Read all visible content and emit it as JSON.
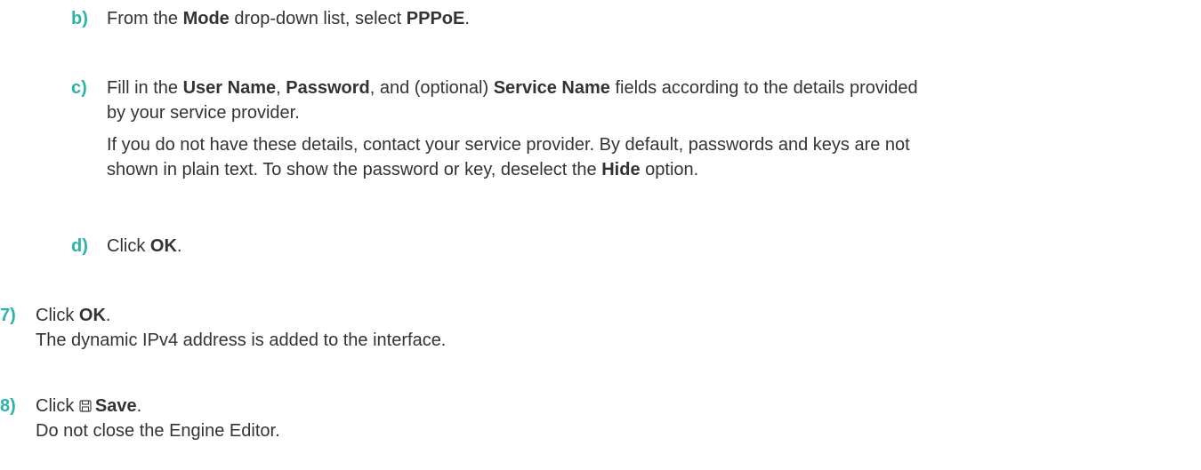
{
  "steps": {
    "b": {
      "marker": "b)",
      "text_1": "From the ",
      "bold_1": "Mode",
      "text_2": " drop-down list, select ",
      "bold_2": "PPPoE",
      "text_3": "."
    },
    "c": {
      "marker": "c)",
      "line1_text_1": "Fill in the ",
      "line1_bold_1": "User Name",
      "line1_text_2": ", ",
      "line1_bold_2": "Password",
      "line1_text_3": ", and (optional) ",
      "line1_bold_3": "Service Name",
      "line1_text_4": " fields according to the details provided",
      "line2_text": "by your service provider.",
      "note_line1": "If you do not have these details, contact your service provider. By default, passwords and keys are not",
      "note_line2_text_1": "shown in plain text. To show the password or key, deselect the ",
      "note_line2_bold": "Hide",
      "note_line2_text_2": " option."
    },
    "d": {
      "marker": "d)",
      "text_1": "Click ",
      "bold_1": "OK",
      "text_2": "."
    },
    "s7": {
      "marker": "7)",
      "text_1": "Click ",
      "bold_1": "OK",
      "text_2": ".",
      "result": "The dynamic IPv4 address is added to the interface."
    },
    "s8": {
      "marker": "8)",
      "text_1": "Click ",
      "icon": "save-icon",
      "bold_1": "Save",
      "text_2": ".",
      "result": "Do not close the Engine Editor."
    }
  },
  "colors": {
    "marker": "#2ab3a6",
    "text": "#333333"
  }
}
